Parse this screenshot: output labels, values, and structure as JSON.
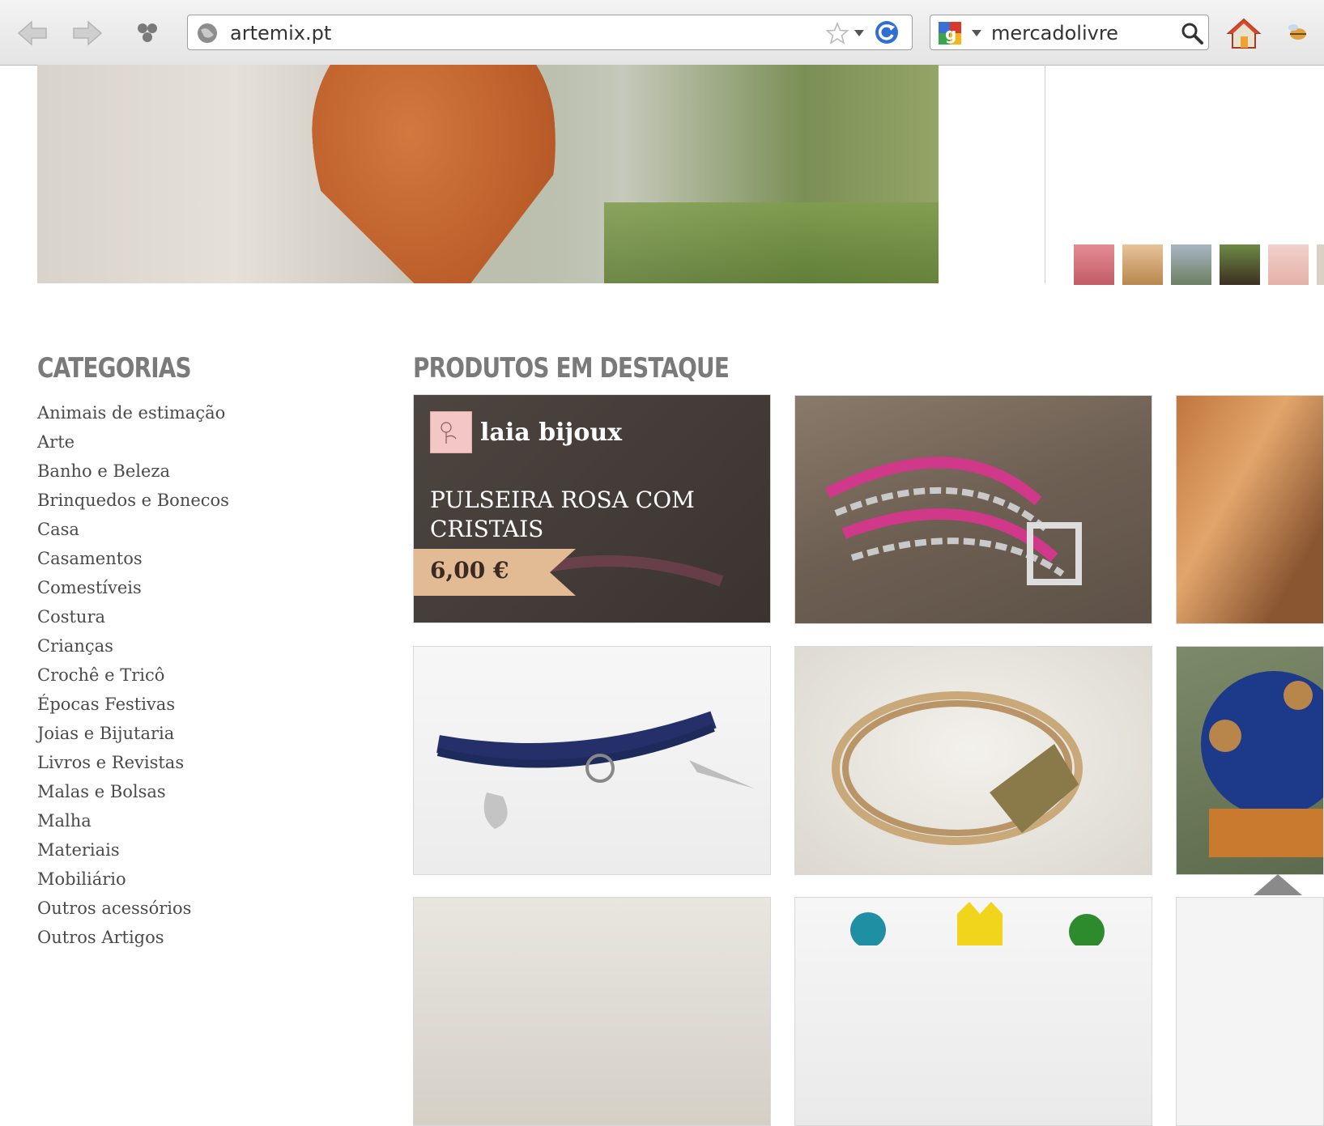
{
  "browser": {
    "url": "artemix.pt",
    "search_query": "mercadolivre"
  },
  "sidebar": {
    "title": "CATEGORIAS",
    "categories": [
      "Animais de estimação",
      "Arte",
      "Banho e Beleza",
      "Brinquedos e Bonecos",
      "Casa",
      "Casamentos",
      "Comestíveis",
      "Costura",
      "Crianças",
      "Crochê e Tricô",
      "Épocas Festivas",
      "Joias e Bijutaria",
      "Livros e Revistas",
      "Malas e Bolsas",
      "Malha",
      "Materiais",
      "Mobiliário",
      "Outros acessórios",
      "Outros Artigos"
    ]
  },
  "featured": {
    "title": "PRODUTOS EM DESTAQUE",
    "highlight": {
      "shop_name": "laia bijoux",
      "product_name": "PULSEIRA ROSA COM CRISTAIS",
      "price": "6,00 €"
    }
  },
  "colors": {
    "heading": "#7a7a7a",
    "price_tag": "#e2bb95",
    "overlay": "#3a3330"
  },
  "icons": [
    "back-arrow-icon",
    "forward-arrow-icon",
    "addon-icon",
    "globe-icon",
    "star-icon",
    "dropdown-icon",
    "reload-icon",
    "google-icon",
    "search-icon",
    "home-icon",
    "extension-icon"
  ]
}
